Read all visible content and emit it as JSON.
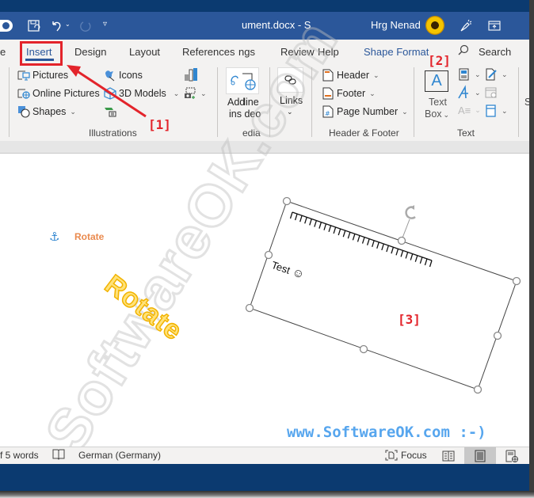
{
  "titlebar": {
    "document_title": "ument.docx  -  S",
    "user_name": "Hrg Nenad",
    "icons": [
      "autosave-toggle",
      "save-icon",
      "undo-icon",
      "redo-icon",
      "customize-qat-icon",
      "avatar",
      "coauthor-icon",
      "ribbon-display-icon"
    ]
  },
  "tabs": [
    {
      "label": "e",
      "name": "tab-home-partial"
    },
    {
      "label": "Insert",
      "name": "tab-insert",
      "active": true
    },
    {
      "label": "Design",
      "name": "tab-design"
    },
    {
      "label": "Layout",
      "name": "tab-layout"
    },
    {
      "label": "References",
      "name": "tab-references"
    },
    {
      "label": "ngs",
      "name": "tab-mailings-partial"
    },
    {
      "label": "Review",
      "name": "tab-review"
    },
    {
      "label": "Help",
      "name": "tab-help"
    },
    {
      "label": "Shape Format",
      "name": "tab-shape-format"
    }
  ],
  "search": {
    "label": "Search"
  },
  "ribbon": {
    "illustrations": {
      "label": "Illustrations",
      "pictures": "Pictures",
      "online_pictures": "Online Pictures",
      "shapes": "Shapes",
      "icons": "Icons",
      "models_3d": "3D Models"
    },
    "media": {
      "label": "edia",
      "addins_line1": "Add",
      "addins_line2": "ins",
      "online_video_line1": "line",
      "online_video_line2": "deo"
    },
    "links": {
      "label": "Links"
    },
    "header_footer": {
      "label": "Header & Footer",
      "header": "Header",
      "footer": "Footer",
      "page_number": "Page Number"
    },
    "text": {
      "label": "Text",
      "text_box_line1": "Text",
      "text_box_line2": "Box",
      "text_box_glyph": "A",
      "partial_right": "S"
    }
  },
  "annotations": {
    "callout_1": "[1]",
    "callout_2": "[2]",
    "callout_3": "[3]",
    "accent_color": "#e3242b"
  },
  "document": {
    "anchor_label": "Rotate",
    "wordart_text": "Rotate",
    "textbox_text": "Test",
    "textbox_emoji": "☺",
    "watermark": "SoftwareOK.com",
    "site_link": "www.SoftwareOK.com :-)"
  },
  "statusbar": {
    "word_count": "f 5 words",
    "language": "German (Germany)",
    "focus": "Focus",
    "active_view": "print-layout"
  },
  "colors": {
    "title_bar": "#2b579a",
    "top_strip": "#0b3a70",
    "ribbon_bg": "#f3f2f1",
    "accent_blue": "#2b579a",
    "wordart_fill": "#ffe27a",
    "anchor_label": "#ea8a4e",
    "link_text": "#57a6ee"
  }
}
